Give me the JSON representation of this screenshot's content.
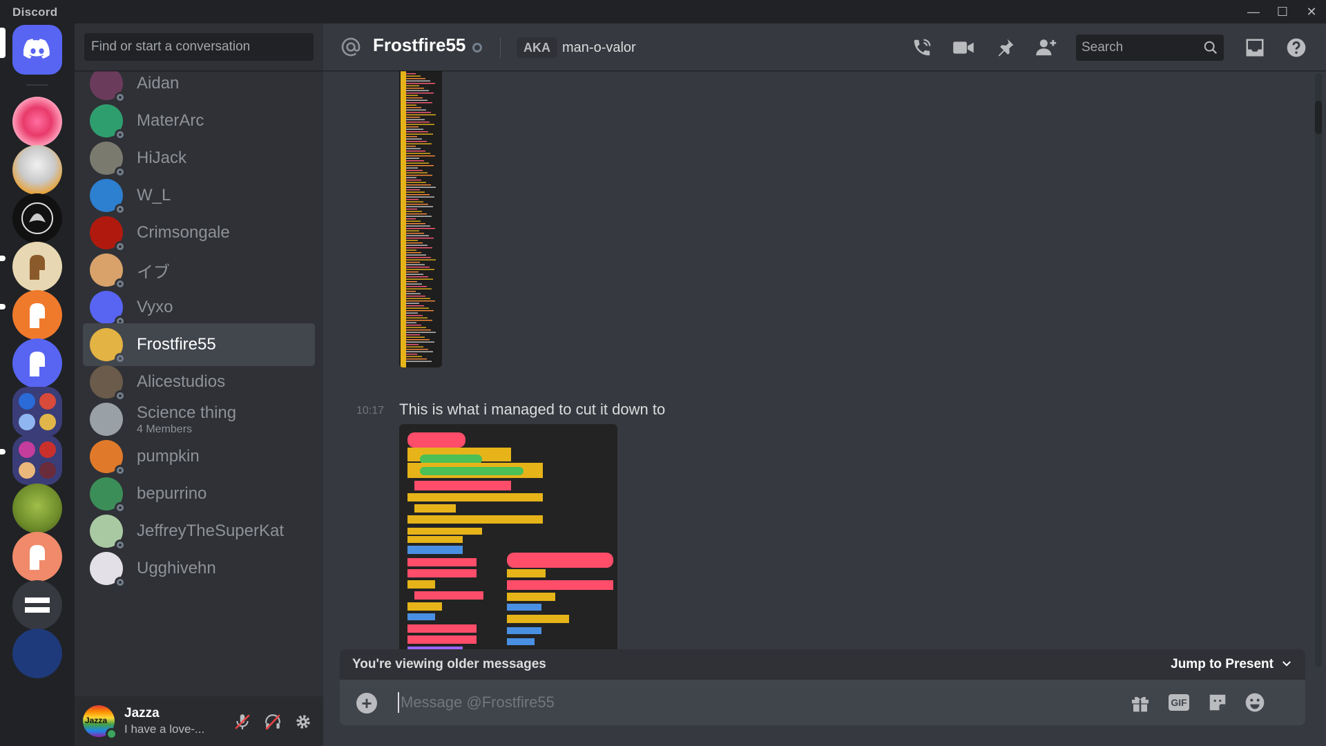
{
  "app": {
    "title": "Discord"
  },
  "window_controls": {
    "minimize": "—",
    "maximize": "☐",
    "close": "✕"
  },
  "sidebar": {
    "search_placeholder": "Find or start a conversation",
    "dms": [
      {
        "name": "Aidan",
        "color": "#6b3b5c"
      },
      {
        "name": "MaterArc",
        "color": "#2f9e6e"
      },
      {
        "name": "HiJack",
        "color": "#7a7a6e"
      },
      {
        "name": "W_L",
        "color": "#2d7fd0"
      },
      {
        "name": "Crimsongale",
        "color": "#b01a0e"
      },
      {
        "name": "イブ",
        "color": "#d8a26a"
      },
      {
        "name": "Vyxo",
        "color": "#5865f2"
      },
      {
        "name": "Frostfire55",
        "color": "#e3b343",
        "active": true
      },
      {
        "name": "Alicestudios",
        "color": "#6a5b4a"
      },
      {
        "name": "Science thing",
        "sub": "4 Members",
        "color": "#9aa1a6"
      },
      {
        "name": "pumpkin",
        "color": "#e07a2a"
      },
      {
        "name": "bepurrino",
        "color": "#3c8e59"
      },
      {
        "name": "JeffreyTheSuperKat",
        "color": "#a9c9a2"
      },
      {
        "name": "Ugghivehn",
        "color": "#e4e0e8"
      }
    ]
  },
  "user": {
    "name": "Jazza",
    "status": "I have a love-...",
    "avatar_text": "Jazza"
  },
  "header": {
    "title": "Frostfire55",
    "aka_label": "AKA",
    "aka_value": "man-o-valor",
    "search_placeholder": "Search"
  },
  "messages": [
    {
      "time": "10:17",
      "text": "This is what i managed to cut it down to"
    }
  ],
  "banner": {
    "text": "You're viewing older messages",
    "jump": "Jump to Present"
  },
  "composer": {
    "placeholder": "Message @Frostfire55",
    "gif_label": "GIF"
  },
  "colors": {
    "accent": "#5865f2",
    "online": "#3ba55d",
    "offline": "#747f8d"
  }
}
